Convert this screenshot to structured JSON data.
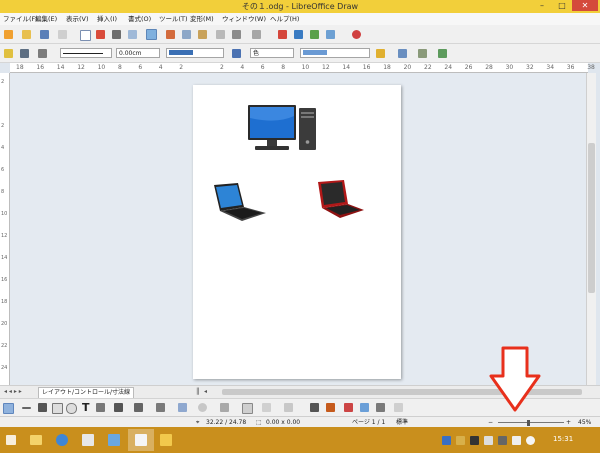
{
  "window": {
    "title": "その１.odg - LibreOffice Draw",
    "minimize": "–",
    "maximize": "□",
    "close": "✕"
  },
  "menu": [
    "ファイル(F)",
    "編集(E)",
    "表示(V)",
    "挿入(I)",
    "書式(O)",
    "ツール(T)",
    "変形(M)",
    "ウィンドウ(W)",
    "ヘルプ(H)"
  ],
  "line_toolbar": {
    "line_width": "0.00cm",
    "fill_type": "色"
  },
  "ruler": {
    "ticks": [
      "18",
      "16",
      "14",
      "12",
      "10",
      "8",
      "6",
      "4",
      "2",
      "",
      "2",
      "4",
      "6",
      "8",
      "10",
      "12",
      "14",
      "16",
      "18",
      "20",
      "22",
      "24",
      "26",
      "28",
      "30",
      "32",
      "34",
      "36",
      "38"
    ]
  },
  "vruler": {
    "ticks": [
      "2",
      "",
      "2",
      "4",
      "6",
      "8",
      "10",
      "12",
      "14",
      "16",
      "18",
      "20",
      "22",
      "24"
    ]
  },
  "tabs": {
    "label": "レイアウト/コントロール/寸法線"
  },
  "status": {
    "position": "32.22 / 24.78",
    "size": "0.00 x 0.00",
    "page": "ページ 1 / 1",
    "style": "標準",
    "zoom": "45%"
  },
  "taskbar": {
    "time": "15:31"
  },
  "colors": {
    "titlebar": "#f2cf3a",
    "taskbar": "#c98f1d",
    "arrow": "#e8301c",
    "monitor_screen": "#1e6fd1",
    "laptop_red": "#b01818"
  }
}
